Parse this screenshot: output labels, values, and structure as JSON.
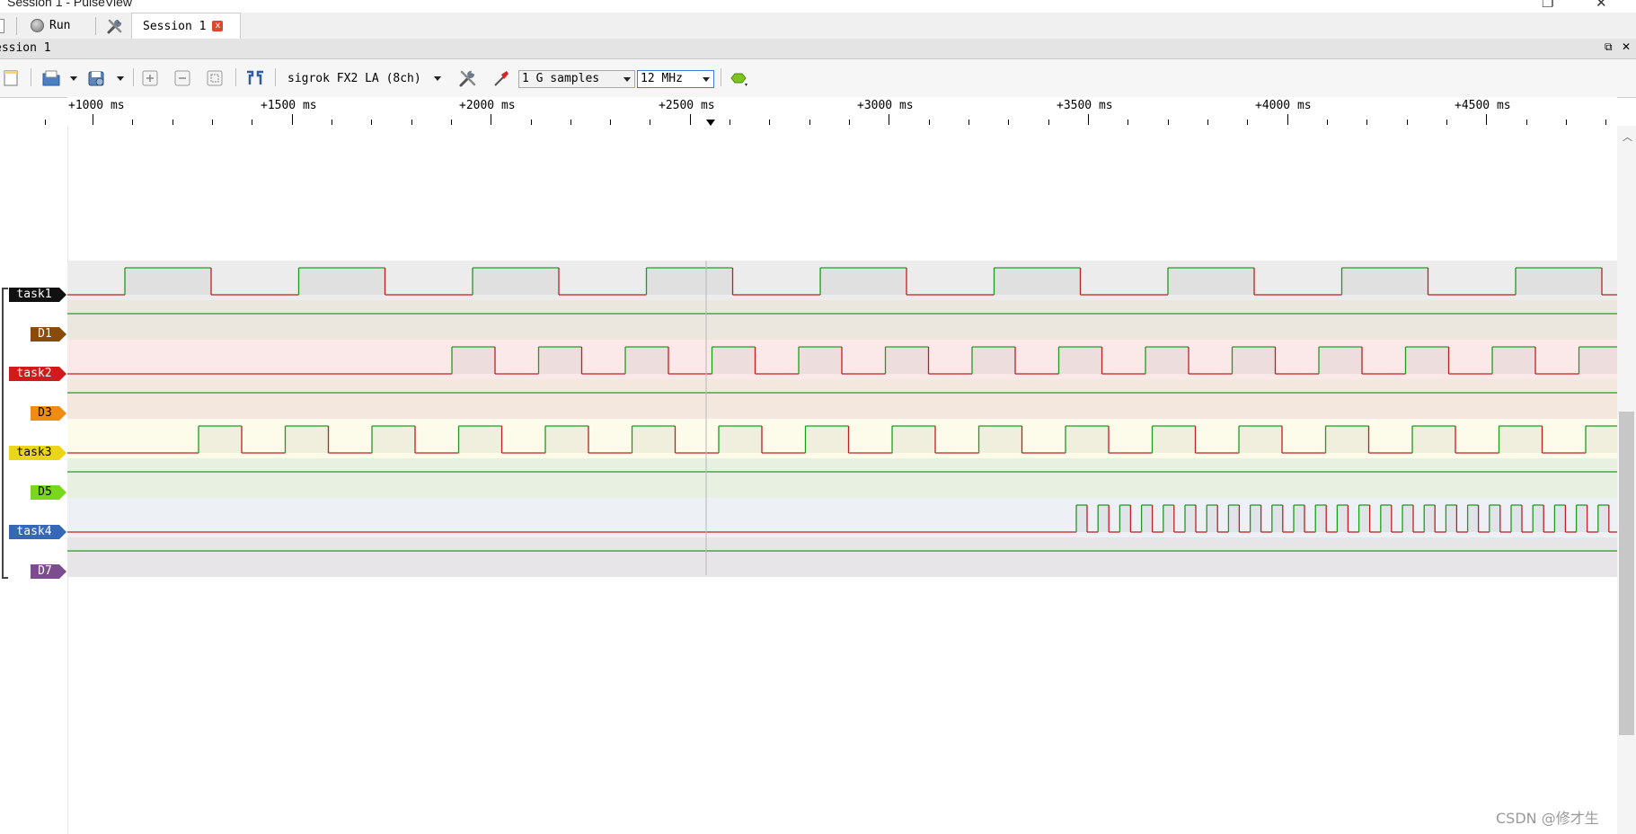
{
  "window": {
    "title": "Session 1 - PulseView"
  },
  "tabbar": {
    "run_label": "Run",
    "session_tab": "Session 1",
    "close_glyph": "x"
  },
  "session": {
    "label": "ession 1"
  },
  "toolbar": {
    "device": "sigrok FX2 LA (8ch)",
    "samples": "1 G samples",
    "rate": "12 MHz"
  },
  "ruler": {
    "labels": [
      "+1000 ms",
      "+1500 ms",
      "+2000 ms",
      "+2500 ms",
      "+3000 ms",
      "+3500 ms",
      "+4000 ms",
      "+4500 ms"
    ]
  },
  "channels": [
    {
      "name": "task1",
      "color": "#111111",
      "lane_bg": "#ececec"
    },
    {
      "name": "D1",
      "color": "#8a4b08",
      "lane_bg": "#ebe7df"
    },
    {
      "name": "task2",
      "color": "#d31a1a",
      "lane_bg": "#fbe9e9"
    },
    {
      "name": "D3",
      "color": "#f08c14",
      "lane_bg": "#f4e8de"
    },
    {
      "name": "task3",
      "color": "#ead51a",
      "lane_bg": "#fdfbe9"
    },
    {
      "name": "D5",
      "color": "#7bd61e",
      "lane_bg": "#e8f0e2"
    },
    {
      "name": "task4",
      "color": "#3668b8",
      "lane_bg": "#edf1f6"
    },
    {
      "name": "D7",
      "color": "#7b4d8e",
      "lane_bg": "#e8e5e9"
    }
  ],
  "watermark": "CSDN @修才生",
  "icons": [
    "run-icon",
    "settings-icon",
    "new-session-icon",
    "open-icon",
    "save-icon",
    "zoom-in-icon",
    "zoom-out-icon",
    "zoom-fit-icon",
    "cursors-icon",
    "device-config-icon",
    "probe-icon",
    "decoder-icon",
    "close-icon",
    "restore-icon"
  ]
}
